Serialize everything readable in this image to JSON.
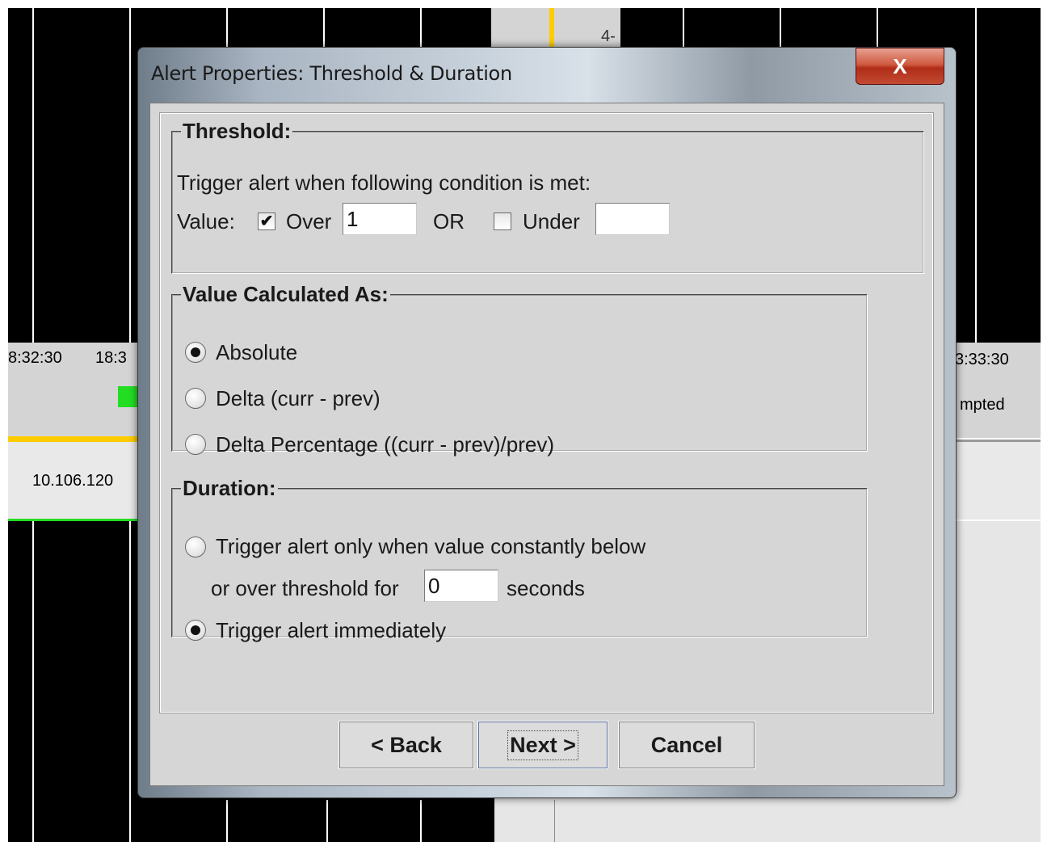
{
  "background": {
    "time_left_1": "8:32:30",
    "time_left_2": "18:3",
    "time_right": "3:33:30",
    "ip_text": "10.106.120",
    "status_text": "mpted",
    "axis_label": "4-",
    "colors": {
      "accent_yellow": "#ffcc00",
      "green": "#22dd22"
    }
  },
  "dialog": {
    "title": "Alert Properties: Threshold & Duration",
    "close_label": "X",
    "threshold": {
      "legend": "Threshold:",
      "instruction": "Trigger alert when following condition is met:",
      "value_label": "Value:",
      "over_checked": true,
      "over_label": "Over",
      "over_value": "1",
      "or_label": "OR",
      "under_checked": false,
      "under_label": "Under",
      "under_value": ""
    },
    "calculated": {
      "legend": "Value Calculated As:",
      "options": [
        "Absolute",
        "Delta (curr - prev)",
        "Delta Percentage ((curr - prev)/prev)"
      ],
      "selected_index": 0
    },
    "duration": {
      "legend": "Duration:",
      "option1_line1": "Trigger alert only when value constantly below",
      "option1_line2": "or over threshold for",
      "seconds_value": "0",
      "seconds_label": "seconds",
      "option2": "Trigger alert immediately",
      "selected": "immediately"
    },
    "buttons": {
      "back": "< Back",
      "next": "Next >",
      "cancel": "Cancel"
    }
  }
}
